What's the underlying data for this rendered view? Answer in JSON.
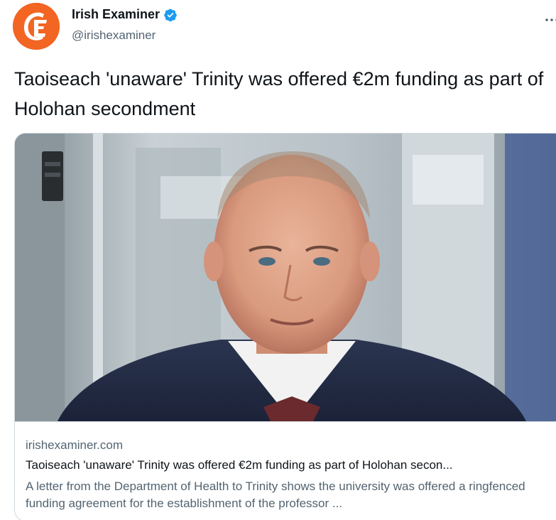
{
  "account": {
    "display_name": "Irish Examiner",
    "handle": "@irishexaminer",
    "verified": true,
    "avatar_icon": "irish-examiner-logo-icon",
    "avatar_color": "#f26522"
  },
  "tweet": {
    "text": "Taoiseach 'unaware' Trinity was offered €2m funding as part of Holohan secondment"
  },
  "card": {
    "image_description_icon": "article-photo",
    "domain": "irishexaminer.com",
    "title": "Taoiseach 'unaware' Trinity was offered €2m funding as part of Holohan secon...",
    "description": "A letter from the Department of Health to Trinity shows the university was offered a ringfenced funding agreement for the establishment of the professor ..."
  },
  "colors": {
    "text_primary": "#0f1419",
    "text_secondary": "#536471",
    "verified_blue": "#1d9bf0",
    "card_border": "#cfd9de"
  }
}
